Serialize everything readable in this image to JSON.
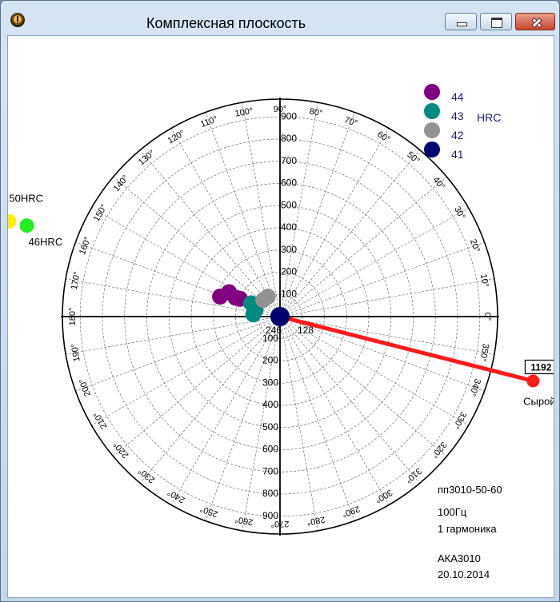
{
  "window": {
    "title": "Комплексная плоскость",
    "icon": "app-logo-icon"
  },
  "plot": {
    "angle_labels": [
      "0°",
      "10°",
      "20°",
      "30°",
      "40°",
      "50°",
      "60°",
      "70°",
      "80°",
      "90°",
      "100°",
      "110°",
      "120°",
      "130°",
      "140°",
      "150°",
      "160°",
      "170°",
      "180°",
      "190°",
      "200°",
      "210°",
      "220°",
      "230°",
      "240°",
      "250°",
      "260°",
      "270°",
      "280°",
      "290°",
      "300°",
      "310°",
      "320°",
      "330°",
      "340°",
      "350°"
    ],
    "radius_up_labels": [
      "100",
      "200",
      "300",
      "400",
      "500",
      "600",
      "700",
      "800",
      "900"
    ],
    "radius_down_labels": [
      "100",
      "200",
      "300",
      "400",
      "500",
      "600",
      "700",
      "800",
      "900"
    ],
    "center_labels": [
      "246",
      "128"
    ],
    "max_radius": 980
  },
  "legend": {
    "title": "HRC",
    "items": [
      {
        "label": "44",
        "color": "#800080"
      },
      {
        "label": "43",
        "color": "#008b80"
      },
      {
        "label": "42",
        "color": "#939393"
      },
      {
        "label": "41",
        "color": "#00006e"
      }
    ]
  },
  "outside_labels": {
    "hrc50": "50HRC",
    "hrc46": "46HRC",
    "raw": "Сырой",
    "raw_value": "1192"
  },
  "info": {
    "line1": "пп3010-50-60",
    "line2": "100Гц",
    "line3": "1 гармоника",
    "line4": "АКА3010",
    "line5": "20.10.2014"
  },
  "colors": {
    "purple": "#800080",
    "teal": "#008b80",
    "gray": "#939393",
    "navy": "#00006e",
    "red": "#ff1a1a",
    "green": "#22ee22",
    "yellow": "#ffee00"
  },
  "chart_data": {
    "type": "scatter",
    "coordinate_system": "polar (complex plane)",
    "radial_range": [
      0,
      980
    ],
    "points": [
      {
        "group": "41",
        "re": 0,
        "im": 0
      },
      {
        "group": "42",
        "re": -55,
        "im": 90
      },
      {
        "group": "42",
        "re": -75,
        "im": 75
      },
      {
        "group": "43",
        "re": -110,
        "im": 30
      },
      {
        "group": "43",
        "re": -130,
        "im": 60
      },
      {
        "group": "43",
        "re": -120,
        "im": 10
      },
      {
        "group": "44",
        "re": -230,
        "im": 110
      },
      {
        "group": "44",
        "re": -270,
        "im": 90
      },
      {
        "group": "44",
        "re": -200,
        "im": 85
      },
      {
        "group": "44",
        "re": -180,
        "im": 80
      },
      {
        "group": "46HRC",
        "re": -1140,
        "im": 410
      },
      {
        "group": "50HRC",
        "re": -1220,
        "im": 430
      },
      {
        "group": "Сырой",
        "re": 1140,
        "im": -290
      }
    ]
  }
}
